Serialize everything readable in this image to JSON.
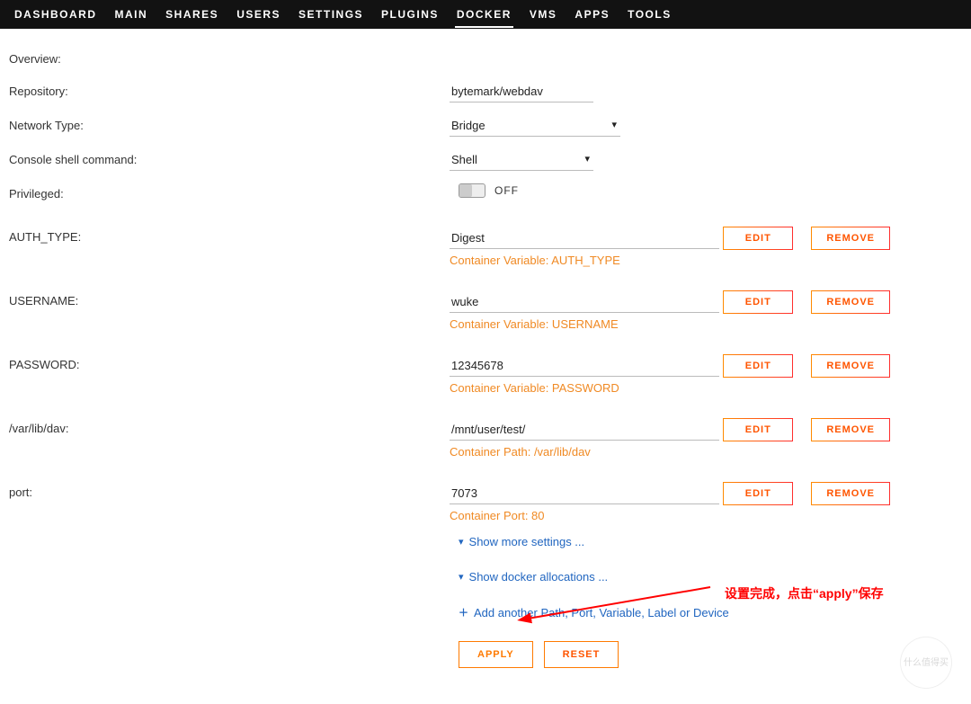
{
  "nav": {
    "items": [
      "DASHBOARD",
      "MAIN",
      "SHARES",
      "USERS",
      "SETTINGS",
      "PLUGINS",
      "DOCKER",
      "VMS",
      "APPS",
      "TOOLS"
    ],
    "active_index": 6
  },
  "form": {
    "overview_label": "Overview:",
    "repository_label": "Repository:",
    "repository_value": "bytemark/webdav",
    "network_label": "Network Type:",
    "network_value": "Bridge",
    "console_label": "Console shell command:",
    "console_value": "Shell",
    "priv_label": "Privileged:",
    "priv_off": "OFF",
    "fields": [
      {
        "label": "AUTH_TYPE:",
        "value": "Digest",
        "caption": "Container Variable: AUTH_TYPE"
      },
      {
        "label": "USERNAME:",
        "value": "wuke",
        "caption": "Container Variable: USERNAME"
      },
      {
        "label": "PASSWORD:",
        "value": "12345678",
        "caption": "Container Variable: PASSWORD"
      },
      {
        "label": "/var/lib/dav:",
        "value": "/mnt/user/test/",
        "caption": "Container Path: /var/lib/dav"
      },
      {
        "label": "port:",
        "value": "7073",
        "caption": "Container Port: 80"
      }
    ],
    "edit_label": "EDIT",
    "remove_label": "REMOVE"
  },
  "links": {
    "show_more": "Show more settings ...",
    "show_alloc": "Show docker allocations ...",
    "add_another": "Add another Path, Port, Variable, Label or Device"
  },
  "actions": {
    "apply": "APPLY",
    "reset": "RESET"
  },
  "annotation": {
    "text": "设置完成，点击“apply”保存"
  },
  "watermark": "什么值得买"
}
